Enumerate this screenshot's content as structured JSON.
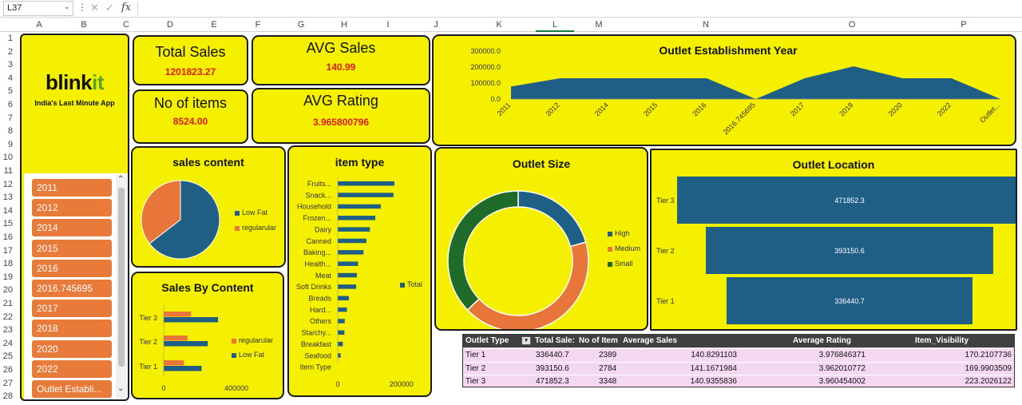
{
  "formula_bar": {
    "name_box": "L37",
    "fx": "fx"
  },
  "columns": [
    "A",
    "B",
    "C",
    "D",
    "E",
    "F",
    "G",
    "H",
    "I",
    "J",
    "K",
    "L",
    "M",
    "N",
    "O",
    "P"
  ],
  "selected_column": "L",
  "rows": [
    "1",
    "2",
    "3",
    "4",
    "5",
    "6",
    "7",
    "8",
    "9",
    "10",
    "11",
    "12",
    "13",
    "14",
    "15",
    "16",
    "17",
    "18",
    "19",
    "20",
    "21",
    "22",
    "23",
    "24",
    "25",
    "26",
    "27",
    "28"
  ],
  "brand": {
    "name_main": "blink",
    "name_accent": "it",
    "tagline": "India's Last Minute App",
    "accent_color": "#5aa32a"
  },
  "kpis": {
    "total_sales": {
      "label": "Total Sales",
      "value": "1201823.27"
    },
    "avg_sales": {
      "label": "AVG Sales",
      "value": "140.99"
    },
    "items": {
      "label": "No of items",
      "value": "8524.00"
    },
    "avg_rating": {
      "label": "AVG Rating",
      "value": "3.965800796"
    }
  },
  "slicer": {
    "items": [
      "2011",
      "2012",
      "2014",
      "2015",
      "2016",
      "2016.745695",
      "2017",
      "2018",
      "2020",
      "2022",
      "Outlet Establi..."
    ]
  },
  "colors": {
    "panel": "#f5ef00",
    "blue": "#1f5f86",
    "orange": "#e8763a",
    "green": "#1e6b2a",
    "button": "#e87a3a",
    "kpi_value": "#e0191c",
    "table_header": "#404040",
    "table_body": "#f4d7f0"
  },
  "chart_data": [
    {
      "type": "area",
      "title": "Outlet Establishment Year",
      "categories": [
        "2011",
        "2012",
        "2014",
        "2015",
        "2016",
        "2016.745695",
        "2017",
        "2018",
        "2020",
        "2022",
        "Outlet..."
      ],
      "values": [
        78000,
        130000,
        130000,
        130000,
        130000,
        0,
        130000,
        205000,
        130000,
        130000,
        0
      ],
      "ylim": [
        0,
        300000
      ],
      "yticks": [
        "300000.0",
        "200000.0",
        "100000.0",
        "0.0"
      ]
    },
    {
      "type": "pie",
      "title": "sales content",
      "categories": [
        "Low Fat",
        "regularular"
      ],
      "values": [
        776000,
        426000
      ]
    },
    {
      "type": "bar",
      "title": "Sales By Content",
      "categories": [
        "Tier 1",
        "Tier 2",
        "Tier 3"
      ],
      "series": [
        {
          "name": "regularular",
          "values": [
            117000,
            138000,
            158000
          ]
        },
        {
          "name": "Low Fat",
          "values": [
            219000,
            255000,
            314000
          ]
        }
      ],
      "xlim": [
        0,
        600000
      ],
      "xticks": [
        "0",
        "400000"
      ]
    },
    {
      "type": "bar",
      "title": "item type",
      "categories": [
        "Fruits...",
        "Snack...",
        "Household",
        "Frozen...",
        "Dairy",
        "Canned",
        "Baking...",
        "Health...",
        "Meat",
        "Soft Drinks",
        "Breads",
        "Hard...",
        "Others",
        "Starchy...",
        "Breakfast",
        "Seafood"
      ],
      "series": [
        {
          "name": "Total",
          "values": [
            178000,
            175000,
            135000,
            118000,
            101000,
            90000,
            81000,
            64000,
            60000,
            58000,
            35000,
            29000,
            22000,
            21000,
            16000,
            9000
          ]
        }
      ],
      "xlim": [
        0,
        350000
      ],
      "xticks": [
        "0",
        "200000"
      ],
      "xlabel": "Item Type"
    },
    {
      "type": "pie",
      "title": "Outlet Size",
      "categories": [
        "High",
        "Medium",
        "Small"
      ],
      "values": [
        248000,
        507000,
        447000
      ]
    },
    {
      "type": "bar",
      "title": "Outlet Location",
      "categories": [
        "Tier 3",
        "Tier 2",
        "Tier 1"
      ],
      "values": [
        471852.3,
        393150.6,
        336440.7
      ],
      "labels": [
        "471852.3",
        "393150.6",
        "336440.7"
      ]
    }
  ],
  "table": {
    "headers": [
      "Outlet Type",
      "Total Sale:",
      "No of Item",
      "Average Sales",
      "Average Rating",
      "Item_Visibility"
    ],
    "rows": [
      [
        "Tier 1",
        "336440.7",
        "2389",
        "140.8291103",
        "3.976846371",
        "170.2107736"
      ],
      [
        "Tier 2",
        "393150.6",
        "2784",
        "141.1671984",
        "3.962010772",
        "169.9903509"
      ],
      [
        "Tier 3",
        "471852.3",
        "3348",
        "140.9355836",
        "3.960454002",
        "223.2026122"
      ]
    ]
  }
}
